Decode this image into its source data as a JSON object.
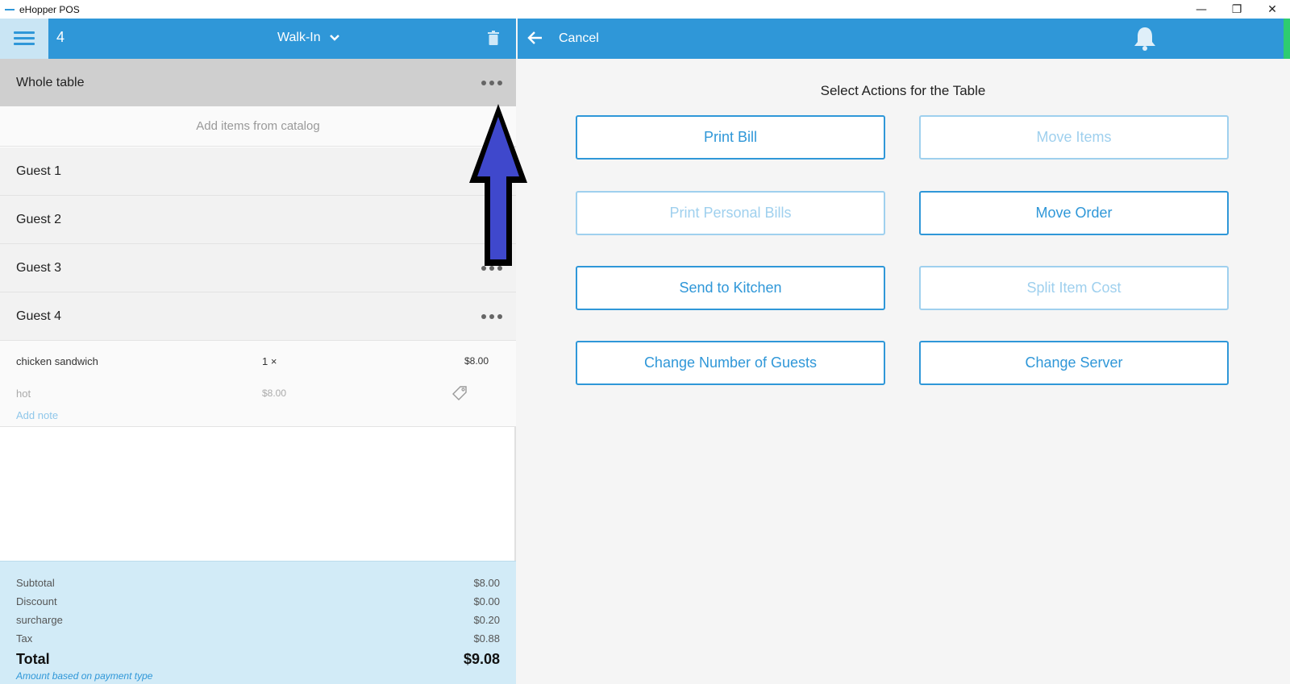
{
  "window": {
    "title": "eHopper POS",
    "controls": [
      "—",
      "❐",
      "✕"
    ]
  },
  "left_panel": {
    "order_number": "4",
    "order_type": "Walk-In",
    "whole_table_label": "Whole table",
    "add_items_label": "Add items from catalog",
    "guests": [
      {
        "label": "Guest 1"
      },
      {
        "label": "Guest 2"
      },
      {
        "label": "Guest 3"
      },
      {
        "label": "Guest 4"
      }
    ],
    "item": {
      "name": "chicken sandwich",
      "qty": "1 ×",
      "price": "$8.00",
      "modifier": "hot",
      "modifier_price": "$8.00",
      "add_note": "Add note"
    },
    "totals": {
      "subtotal_label": "Subtotal",
      "subtotal": "$8.00",
      "discount_label": "Discount",
      "discount": "$0.00",
      "surcharge_label": "surcharge",
      "surcharge": "$0.20",
      "tax_label": "Tax",
      "tax": "$0.88",
      "total_label": "Total",
      "total": "$9.08",
      "hint": "Amount based on payment type"
    }
  },
  "right_panel": {
    "cancel_label": "Cancel",
    "title": "Select Actions for the Table",
    "actions": {
      "print_bill": "Print Bill",
      "move_items": "Move Items",
      "print_personal_bills": "Print Personal Bills",
      "move_order": "Move Order",
      "send_to_kitchen": "Send to Kitchen",
      "split_item_cost": "Split Item Cost",
      "change_guests": "Change Number of Guests",
      "change_server": "Change Server"
    }
  },
  "colors": {
    "accent": "#2f97d8",
    "disabled": "#9fd0ee",
    "arrow": "#3f48cc"
  }
}
